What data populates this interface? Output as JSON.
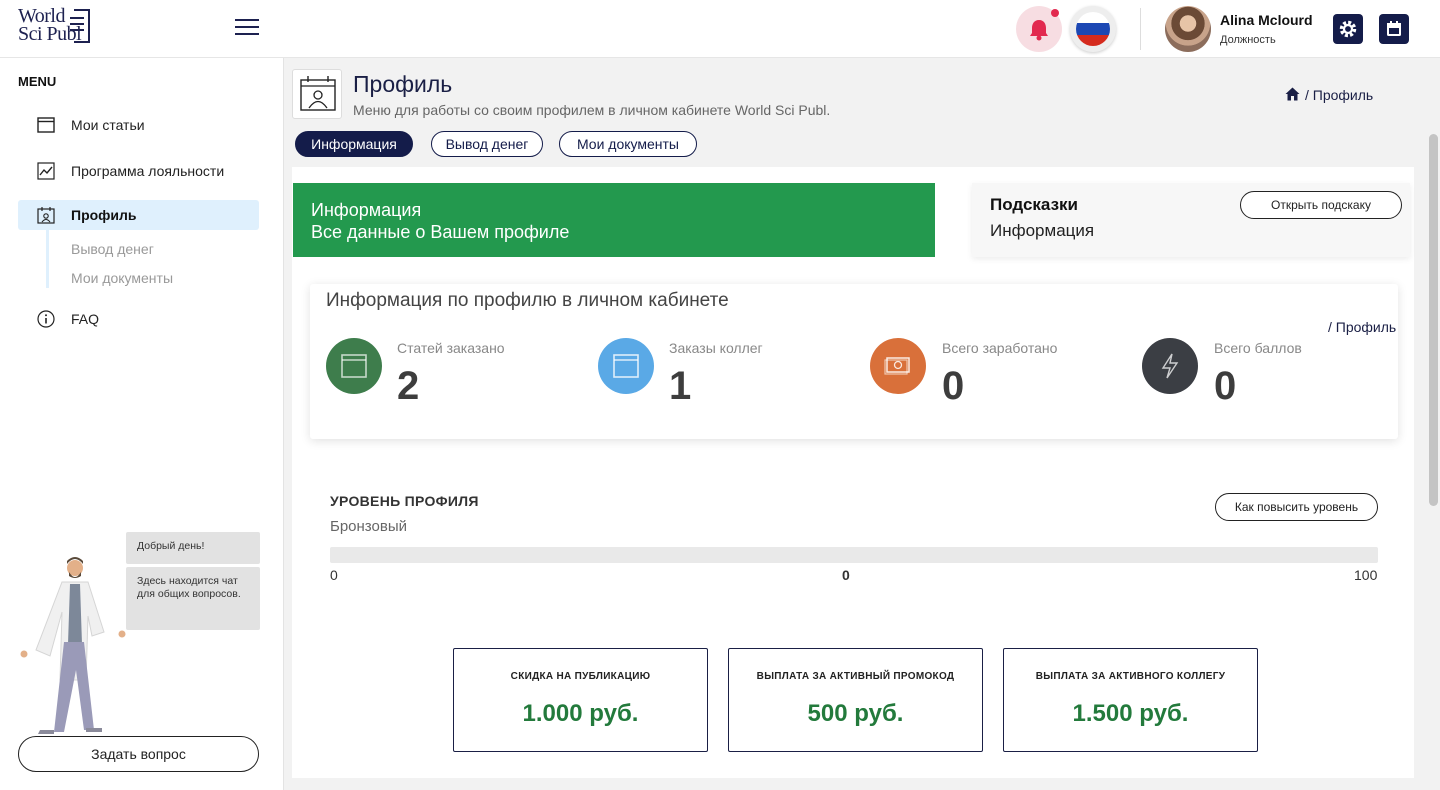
{
  "header": {
    "logo_line1": "World",
    "logo_line2": "Sci Publ",
    "user_name": "Alina Mclourd",
    "user_role": "Должность"
  },
  "sidebar": {
    "menu_title": "MENU",
    "items": [
      {
        "label": "Мои статьи",
        "icon": "article-icon"
      },
      {
        "label": "Программа лояльности",
        "icon": "chart-line-icon"
      },
      {
        "label": "Профиль",
        "icon": "profile-icon"
      },
      {
        "label": "FAQ",
        "icon": "info-icon"
      }
    ],
    "sub_items": [
      {
        "label": "Вывод денег"
      },
      {
        "label": "Мои документы"
      }
    ],
    "chat_greeting": "Добрый день!",
    "chat_text": "Здесь находится чат для общих вопросов.",
    "ask_button": "Задать вопрос"
  },
  "page": {
    "title": "Профиль",
    "subtitle": "Меню для работы со своим профилем в личном кабинете World Sci Publ.",
    "breadcrumb": "/ Профиль",
    "tabs": [
      {
        "label": "Информация",
        "active": true
      },
      {
        "label": "Вывод денег",
        "active": false
      },
      {
        "label": "Мои документы",
        "active": false
      }
    ]
  },
  "info_banner": {
    "line1": "Информация",
    "line2": "Все данные о Вашем профиле",
    "color": "#23994e"
  },
  "hints": {
    "title": "Подсказки",
    "text": "Информация",
    "button": "Открыть подскаку"
  },
  "stats": {
    "title": "Информация по профилю в личном кабинете",
    "breadcrumb": "/ Профиль",
    "items": [
      {
        "label": "Статей заказано",
        "value": "2",
        "color": "#3e7d4c",
        "icon": "article-icon"
      },
      {
        "label": "Заказы коллег",
        "value": "1",
        "color": "#5aa9e6",
        "icon": "window-icon"
      },
      {
        "label": "Всего заработано",
        "value": "0",
        "color": "#d9703a",
        "icon": "money-icon"
      },
      {
        "label": "Всего баллов",
        "value": "0",
        "color": "#3b3e44",
        "icon": "lightning-icon"
      }
    ]
  },
  "level": {
    "title": "УРОВЕНЬ ПРОФИЛЯ",
    "name": "Бронзовый",
    "button": "Как повысить уровень",
    "min": "0",
    "current": "0",
    "max": "100",
    "progress_fraction": 0
  },
  "bonuses": [
    {
      "title": "СКИДКА НА ПУБЛИКАЦИЮ",
      "value": "1.000 руб."
    },
    {
      "title": "ВЫПЛАТА ЗА АКТИВНЫЙ ПРОМОКОД",
      "value": "500 руб."
    },
    {
      "title": "ВЫПЛАТА ЗА АКТИВНОГО КОЛЛЕГУ",
      "value": "1.500 руб."
    }
  ]
}
